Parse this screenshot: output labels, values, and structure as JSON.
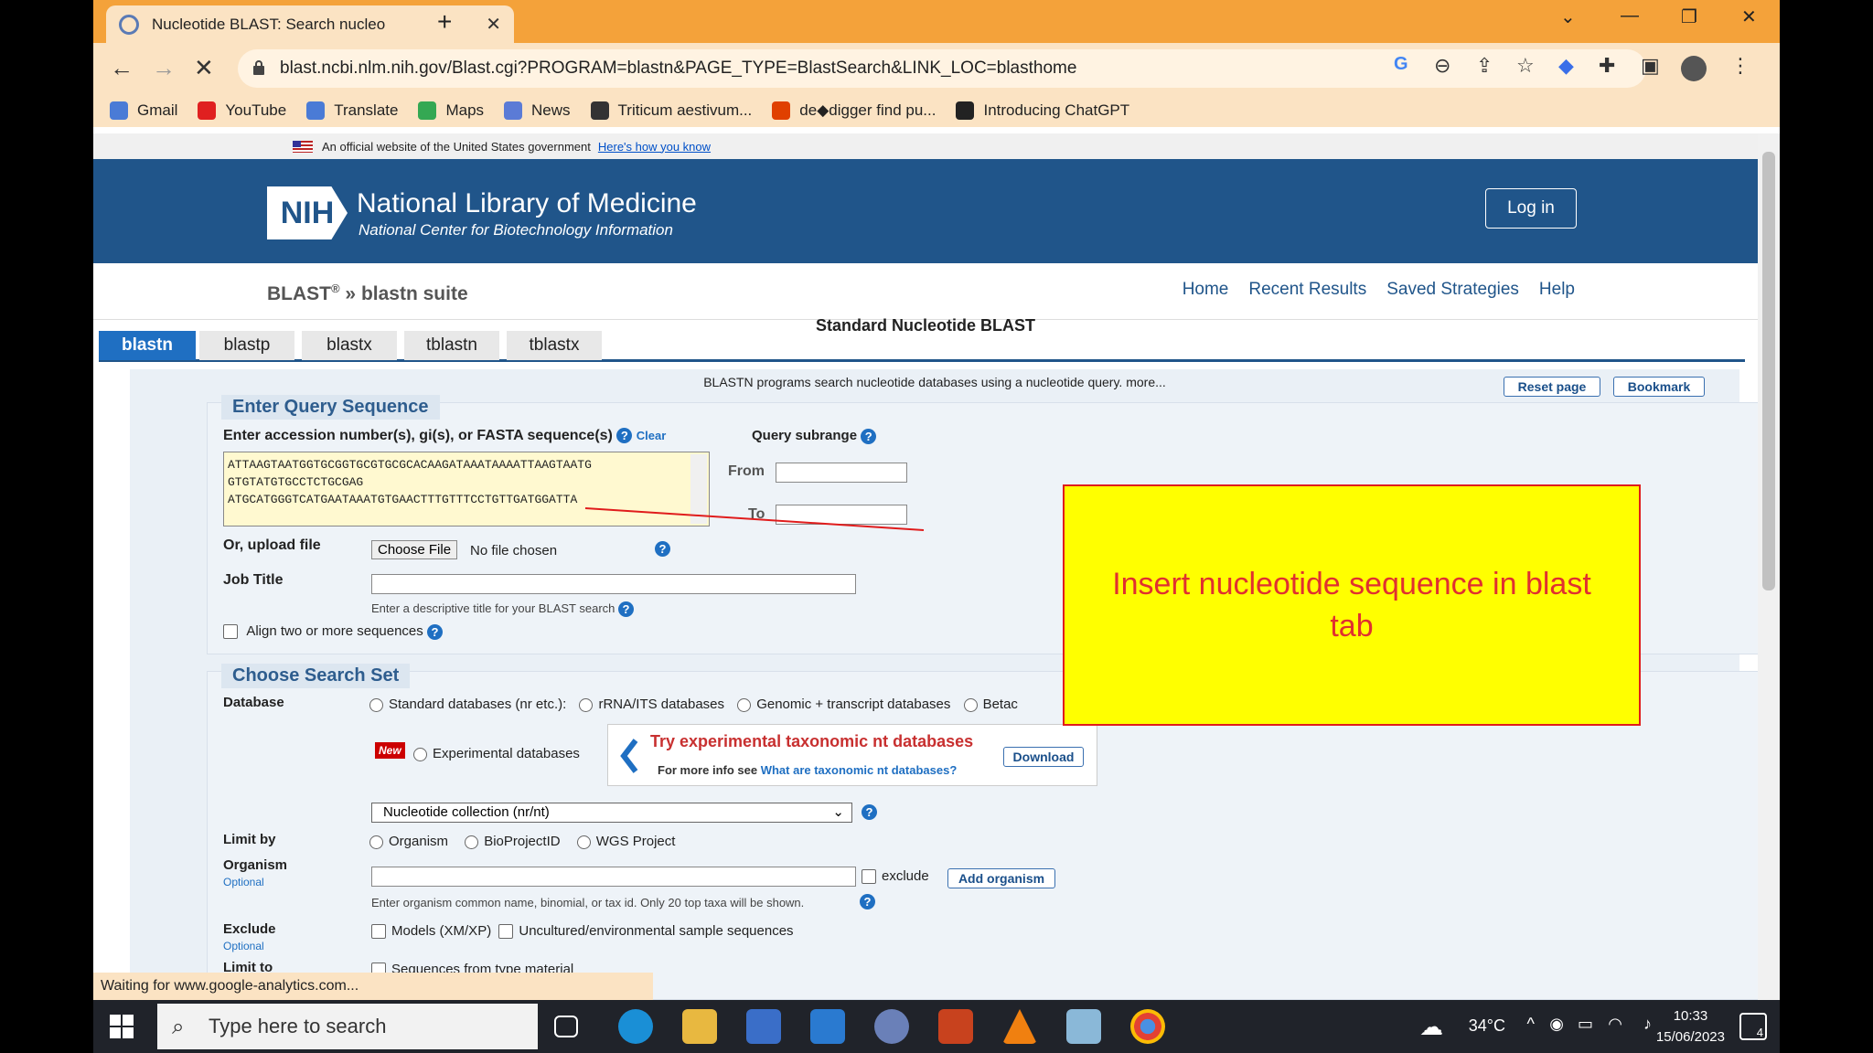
{
  "browser": {
    "tab_title": "Nucleotide BLAST: Search nucleo",
    "url": "blast.ncbi.nlm.nih.gov/Blast.cgi?PROGRAM=blastn&PAGE_TYPE=BlastSearch&LINK_LOC=blasthome",
    "bookmarks": [
      {
        "label": "Gmail",
        "icon": "gmail-icon",
        "color": "#4a7bd6"
      },
      {
        "label": "YouTube",
        "icon": "youtube-icon",
        "color": "#e02020"
      },
      {
        "label": "Translate",
        "icon": "translate-icon",
        "color": "#4a7bd6"
      },
      {
        "label": "Maps",
        "icon": "maps-icon",
        "color": "#34a853"
      },
      {
        "label": "News",
        "icon": "news-icon",
        "color": "#5b7bd6"
      },
      {
        "label": "Triticum aestivum...",
        "icon": "bookmark-icon",
        "color": "#333333"
      },
      {
        "label": "de◆digger find pu...",
        "icon": "bookmark-icon",
        "color": "#e04000"
      },
      {
        "label": "Introducing ChatGPT",
        "icon": "chatgpt-icon",
        "color": "#222222"
      }
    ],
    "status_text": "Waiting for www.google-analytics.com..."
  },
  "gov_banner": {
    "text": "An official website of the United States government",
    "link": "Here's how you know"
  },
  "header": {
    "logo": "NIH",
    "title": "National Library of Medicine",
    "subtitle": "National Center for Biotechnology Information",
    "login": "Log in"
  },
  "blast": {
    "crumb_main": "BLAST",
    "crumb_sup": "®",
    "crumb_rest": " » blastn suite",
    "nav": [
      "Home",
      "Recent Results",
      "Saved Strategies",
      "Help"
    ],
    "page_title": "Standard Nucleotide BLAST",
    "tabs": [
      "blastn",
      "blastp",
      "blastx",
      "tblastn",
      "tblastx"
    ],
    "active_tab": "blastn",
    "description": "BLASTN programs search nucleotide databases using a nucleotide query. more...",
    "reset": "Reset page",
    "bookmark": "Bookmark"
  },
  "query": {
    "legend": "Enter Query Sequence",
    "label": "Enter accession number(s), gi(s), or FASTA sequence(s)",
    "clear": "Clear",
    "subrange": "Query subrange",
    "from": "From",
    "to": "To",
    "sequence_lines": [
      "ATTAAGTAATGGTGCGGTGCGTGCGCACAAGATAAATAAAATTAAGTAATG",
      "GTGTATGTGCCTCTGCGAG",
      "ATGCATGGGTCATGAATAAATGTGAACTTTGTTTCCTGTTGATGGATTA"
    ],
    "upload_label": "Or, upload file",
    "choose_file": "Choose File",
    "no_file": "No file chosen",
    "job_title_label": "Job Title",
    "job_title_hint": "Enter a descriptive title for your BLAST search",
    "align": "Align two or more sequences"
  },
  "search_set": {
    "legend": "Choose Search Set",
    "database_label": "Database",
    "db_options": [
      "Standard databases (nr etc.):",
      "rRNA/ITS databases",
      "Genomic + transcript databases",
      "Betac"
    ],
    "new_badge": "New",
    "experimental": "Experimental databases",
    "promo_title": "Try experimental taxonomic nt databases",
    "promo_text": "For more info see",
    "promo_link": "What are taxonomic nt databases?",
    "download": "Download",
    "collection": "Nucleotide collection (nr/nt)",
    "limit_by_label": "Limit by",
    "limit_options": [
      "Organism",
      "BioProjectID",
      "WGS Project"
    ],
    "organism_label": "Organism",
    "optional": "Optional",
    "exclude": "exclude",
    "add_organism": "Add organism",
    "organism_hint": "Enter organism common name, binomial, or tax id. Only 20 top taxa will be shown.",
    "exclude_label": "Exclude",
    "exclude_models": "Models (XM/XP)",
    "exclude_uncultured": "Uncultured/environmental sample sequences",
    "limit_to_label": "Limit to",
    "limit_to_option": "Sequences from type material"
  },
  "annotation": {
    "text": "Insert nucleotide sequence in blast tab",
    "fill": "#ffff00",
    "text_color": "#e03030"
  },
  "taskbar": {
    "search_placeholder": "Type here to search",
    "weather": "34°C",
    "time": "10:33",
    "date": "15/06/2023",
    "notifications": "4"
  }
}
